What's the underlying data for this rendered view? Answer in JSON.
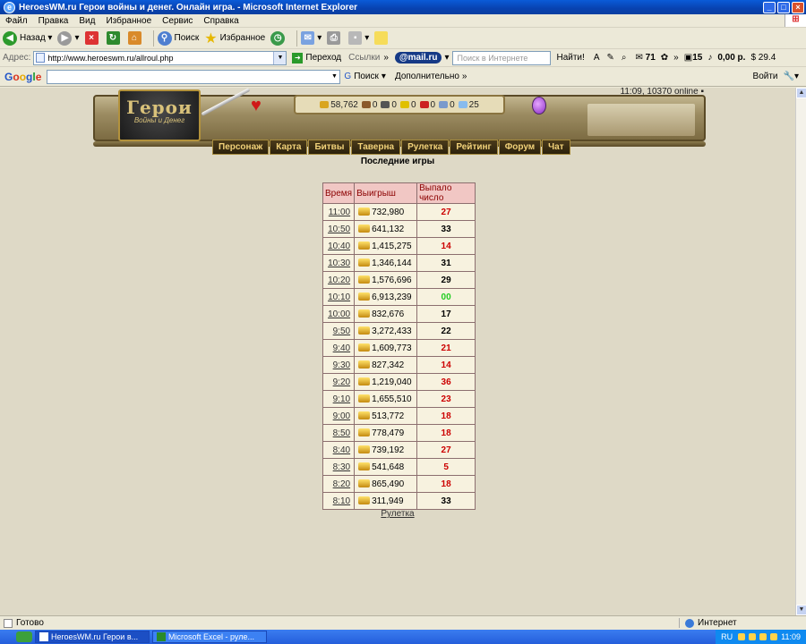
{
  "window": {
    "title": "HeroesWM.ru Герои войны и денег. Онлайн игра. - Microsoft Internet Explorer",
    "icon_name": "ie-icon"
  },
  "menu": [
    "Файл",
    "Правка",
    "Вид",
    "Избранное",
    "Сервис",
    "Справка"
  ],
  "toolbar": {
    "back_label": "Назад",
    "search_label": "Поиск",
    "favorites_label": "Избранное"
  },
  "addressbar": {
    "label": "Адрес:",
    "url": "http://www.heroeswm.ru/allroul.php",
    "go_label": "Переход",
    "links_label": "Ссылки",
    "mail_label": "@mail.ru",
    "search_placeholder": "Поиск в Интернете",
    "find_label": "Найти!",
    "counter_mail": "71",
    "counter_15": "15",
    "money_1": "0,00 р.",
    "money_2": "29.4"
  },
  "googlebar": {
    "logo": "Google",
    "search_label": "Поиск",
    "more_label": "Дополнительно",
    "signin_label": "Войти"
  },
  "game": {
    "online": "11:09, 10370 online",
    "logo_title": "Герои",
    "logo_subtitle": "Войны и Денег",
    "resources": [
      {
        "value": "58,762",
        "color": "#d9a520"
      },
      {
        "value": "0",
        "color": "#8b5a2b"
      },
      {
        "value": "0",
        "color": "#555555"
      },
      {
        "value": "0",
        "color": "#e0c000"
      },
      {
        "value": "0",
        "color": "#cc2222"
      },
      {
        "value": "0",
        "color": "#7a9acc"
      },
      {
        "value": "25",
        "color": "#88bbee"
      }
    ],
    "nav": [
      "Персонаж",
      "Карта",
      "Битвы",
      "Таверна",
      "Рулетка",
      "Рейтинг",
      "Форум",
      "Чат"
    ],
    "heading": "Последние игры",
    "table_headers": [
      "Время",
      "Выигрыш",
      "Выпало число"
    ],
    "rows": [
      {
        "time": "11:00",
        "win": "732,980",
        "num": "27",
        "color": "#cc0000"
      },
      {
        "time": "10:50",
        "win": "641,132",
        "num": "33",
        "color": "#000000"
      },
      {
        "time": "10:40",
        "win": "1,415,275",
        "num": "14",
        "color": "#cc0000"
      },
      {
        "time": "10:30",
        "win": "1,346,144",
        "num": "31",
        "color": "#000000"
      },
      {
        "time": "10:20",
        "win": "1,576,696",
        "num": "29",
        "color": "#000000"
      },
      {
        "time": "10:10",
        "win": "6,913,239",
        "num": "00",
        "color": "#22cc22"
      },
      {
        "time": "10:00",
        "win": "832,676",
        "num": "17",
        "color": "#000000"
      },
      {
        "time": "9:50",
        "win": "3,272,433",
        "num": "22",
        "color": "#000000"
      },
      {
        "time": "9:40",
        "win": "1,609,773",
        "num": "21",
        "color": "#cc0000"
      },
      {
        "time": "9:30",
        "win": "827,342",
        "num": "14",
        "color": "#cc0000"
      },
      {
        "time": "9:20",
        "win": "1,219,040",
        "num": "36",
        "color": "#cc0000"
      },
      {
        "time": "9:10",
        "win": "1,655,510",
        "num": "23",
        "color": "#cc0000"
      },
      {
        "time": "9:00",
        "win": "513,772",
        "num": "18",
        "color": "#cc0000"
      },
      {
        "time": "8:50",
        "win": "778,479",
        "num": "18",
        "color": "#cc0000"
      },
      {
        "time": "8:40",
        "win": "739,192",
        "num": "27",
        "color": "#cc0000"
      },
      {
        "time": "8:30",
        "win": "541,648",
        "num": "5",
        "color": "#cc0000"
      },
      {
        "time": "8:20",
        "win": "865,490",
        "num": "18",
        "color": "#cc0000"
      },
      {
        "time": "8:10",
        "win": "311,949",
        "num": "33",
        "color": "#000000"
      }
    ],
    "footer_link": "Рулетка"
  },
  "status": {
    "text": "Готово",
    "zone": "Интернет"
  },
  "taskbar": {
    "tasks": [
      "HeroesWM.ru Герои в...",
      "Microsoft Excel - руле..."
    ],
    "lang": "RU",
    "clock": "11:09"
  }
}
